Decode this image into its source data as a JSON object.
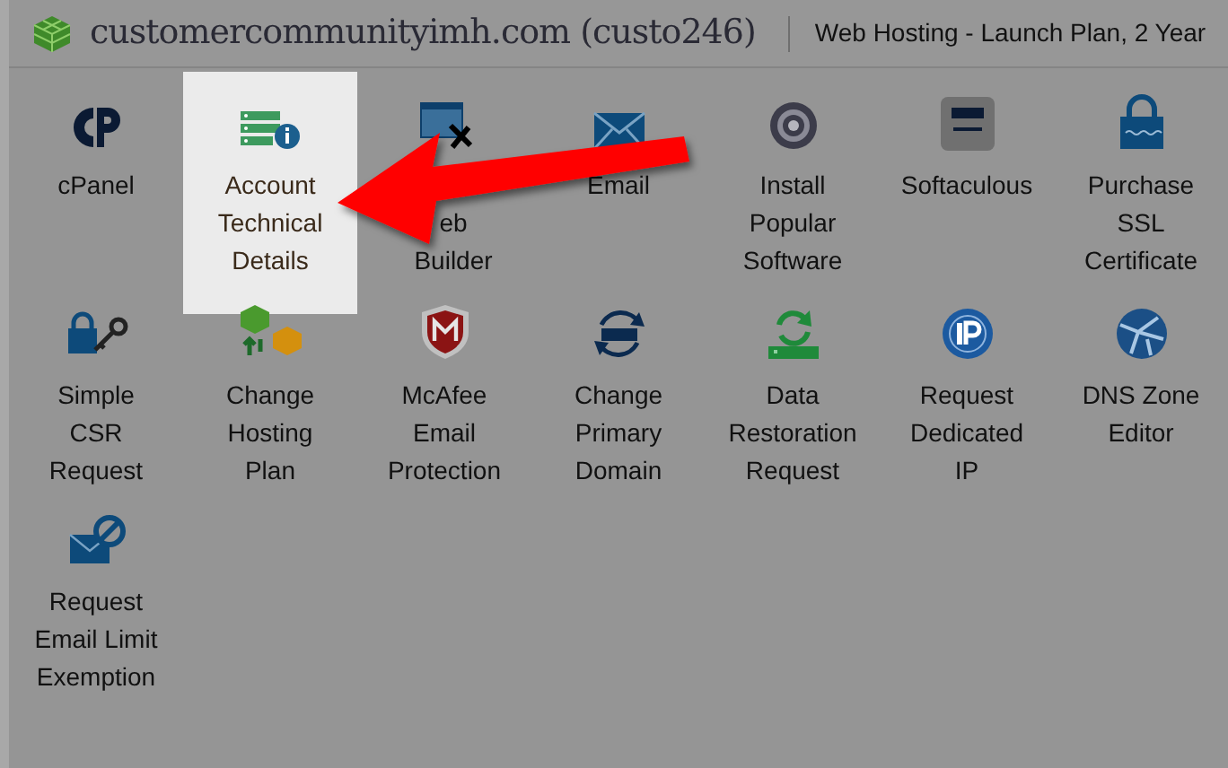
{
  "header": {
    "domain": "customercommunityimh.com (custo246)",
    "plan": "Web Hosting - Launch Plan, 2 Year"
  },
  "items": [
    {
      "lines": [
        "cPanel"
      ],
      "selected": false
    },
    {
      "lines": [
        "Account",
        "Technical",
        "Details"
      ],
      "selected": true
    },
    {
      "lines": [
        "eb",
        "Builder"
      ],
      "first_line_covered": true,
      "selected": false
    },
    {
      "lines": [
        "Email"
      ],
      "selected": false
    },
    {
      "lines": [
        "Install",
        "Popular",
        "Software"
      ],
      "selected": false
    },
    {
      "lines": [
        "Softaculous"
      ],
      "selected": false
    },
    {
      "lines": [
        "Purchase",
        "SSL",
        "Certificate"
      ],
      "selected": false
    },
    {
      "lines": [
        "Simple",
        "CSR",
        "Request"
      ],
      "selected": false
    },
    {
      "lines": [
        "Change",
        "Hosting",
        "Plan"
      ],
      "selected": false
    },
    {
      "lines": [
        "McAfee",
        "Email",
        "Protection"
      ],
      "selected": false
    },
    {
      "lines": [
        "Change",
        "Primary",
        "Domain"
      ],
      "selected": false
    },
    {
      "lines": [
        "Data",
        "Restoration",
        "Request"
      ],
      "selected": false
    },
    {
      "lines": [
        "Request",
        "Dedicated",
        "IP"
      ],
      "selected": false
    },
    {
      "lines": [
        "DNS Zone",
        "Editor"
      ],
      "selected": false
    },
    {
      "lines": [
        "Request",
        "Email Limit",
        "Exemption"
      ],
      "selected": false
    }
  ]
}
